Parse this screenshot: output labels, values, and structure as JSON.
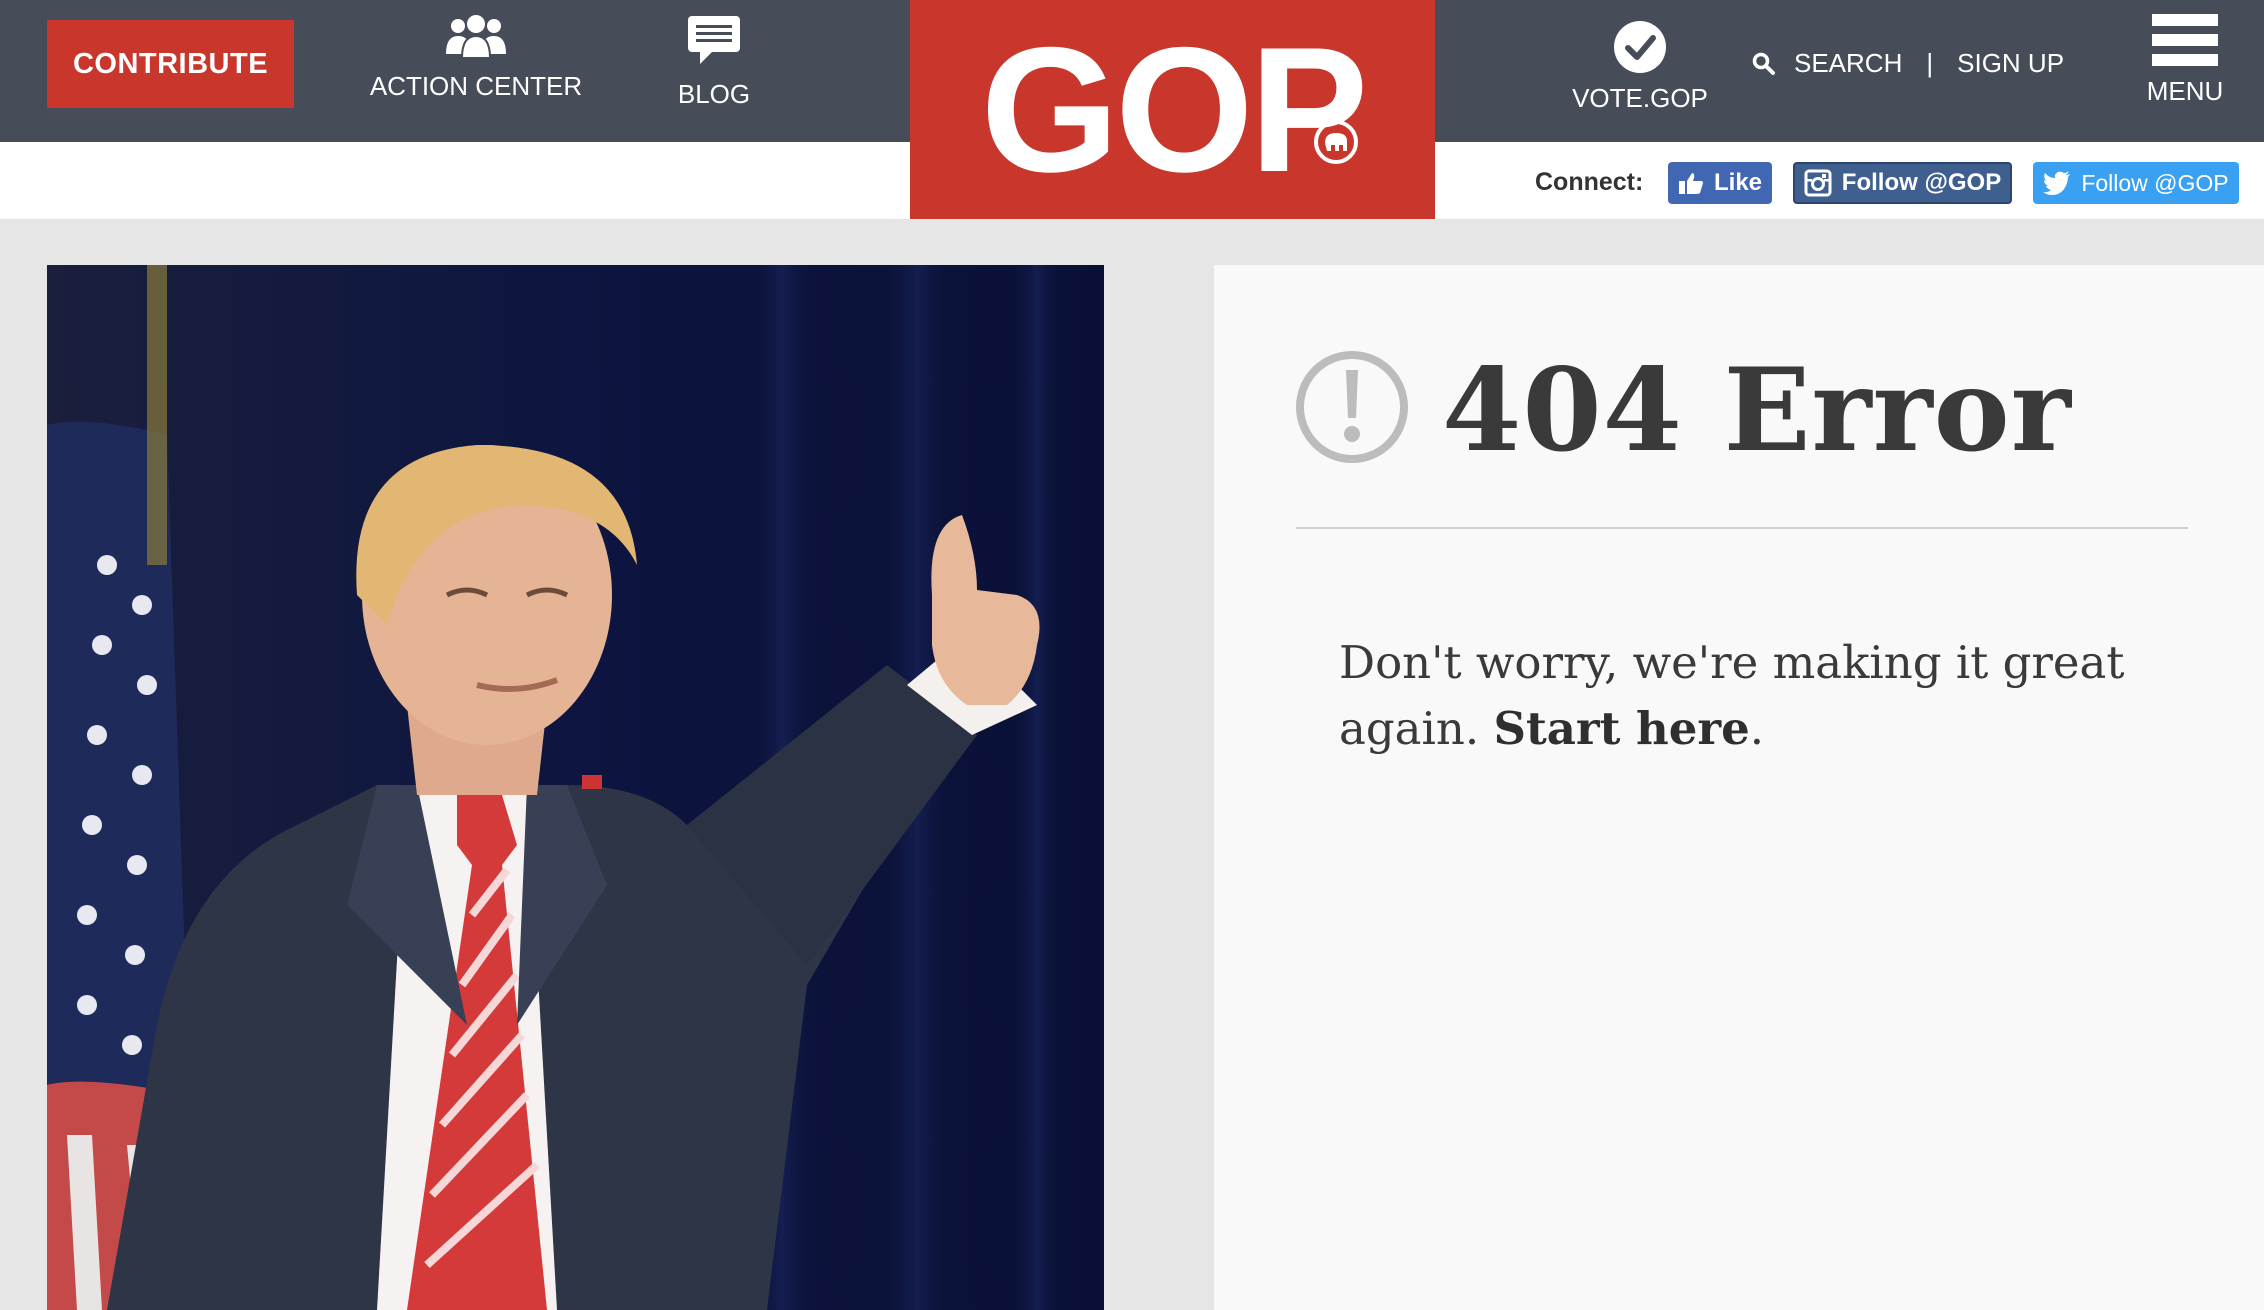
{
  "header": {
    "contribute_label": "CONTRIBUTE",
    "action_center_label": "ACTION CENTER",
    "blog_label": "BLOG",
    "logo_text": "GOP",
    "vote_label": "VOTE.GOP",
    "search_label": "SEARCH",
    "separator": "|",
    "signup_label": "SIGN UP",
    "menu_label": "MENU"
  },
  "connect": {
    "label": "Connect:",
    "facebook_label": "Like",
    "instagram_label": "Follow @GOP",
    "twitter_label": "Follow @GOP"
  },
  "error": {
    "title": "404 Error",
    "message_prefix": "Don't worry, we're making it great again. ",
    "link_text": "Start here",
    "message_suffix": "."
  },
  "colors": {
    "header_bg": "#474d58",
    "brand_red": "#c9372c",
    "page_bg": "#e6e6e6",
    "panel_bg": "#f9f9f9",
    "facebook": "#4267b2",
    "instagram": "#3f5f8f",
    "twitter": "#3aa1f2"
  },
  "icons": {
    "action_center": "group-people-icon",
    "blog": "speech-bubble-icon",
    "vote": "checkmark-circle-icon",
    "search": "magnifier-icon",
    "menu": "hamburger-icon",
    "error": "exclamation-circle-icon"
  }
}
